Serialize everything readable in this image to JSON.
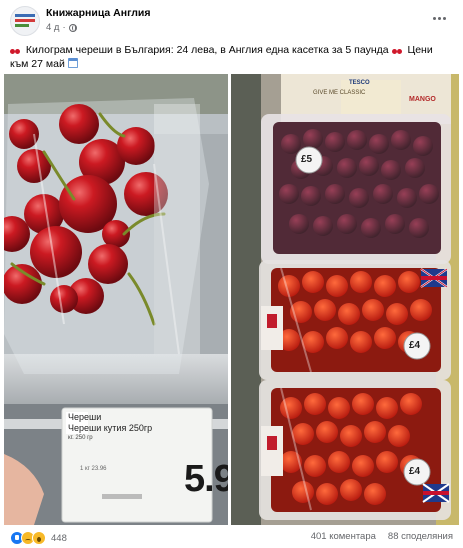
{
  "header": {
    "page_name": "Книжарница Англия",
    "time": "4 д"
  },
  "post": {
    "text": "Килограм череши в България: 24 лева, в Англия една касетка за 5 паунда",
    "text2": "Цени към 27 май"
  },
  "photo_left": {
    "label_line1": "Череши",
    "label_line2": "Череши кутия 250гр",
    "label_small": "кг. 250 гр",
    "label_tiny": "1 кг 23.96",
    "price": "5.9",
    "price_small": "9"
  },
  "photo_right": {
    "price_cherries": "£5",
    "price_straw1": "£4",
    "price_straw2": "£4",
    "box_label": "TESCO",
    "box_sub": "MANGO",
    "box_brand": "GIVE ME CLASSIC"
  },
  "footer": {
    "reaction_count": "448",
    "comments": "401 коментара",
    "shares": "88 споделяния"
  },
  "colors": {
    "brand_blue": "#1877f2",
    "cherry_red": "#b3101c",
    "strawberry_red": "#d9331a"
  }
}
